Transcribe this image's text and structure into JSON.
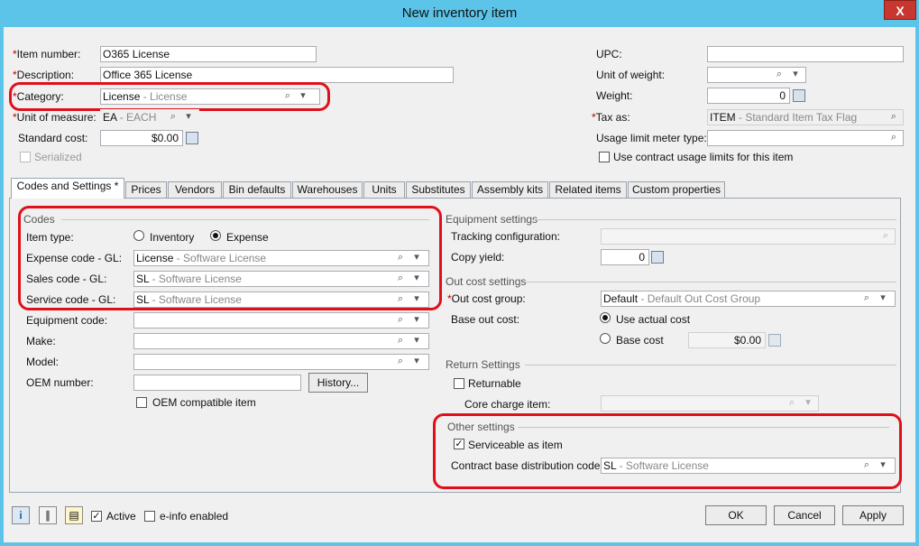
{
  "window": {
    "title": "New inventory item",
    "close": "X"
  },
  "header": {
    "item_number_label": "Item number:",
    "item_number": "O365 License",
    "description_label": "Description:",
    "description": "Office 365 License",
    "category_label": "Category:",
    "category_code": "License",
    "category_desc": "License",
    "uom_label": "Unit of measure:",
    "uom_code": "EA",
    "uom_desc": "EACH",
    "standard_cost_label": "Standard cost:",
    "standard_cost": "$0.00",
    "serialized_label": "Serialized",
    "upc_label": "UPC:",
    "upc": "",
    "unit_weight_label": "Unit of weight:",
    "weight_label": "Weight:",
    "weight": "0",
    "tax_label": "Tax as:",
    "tax_code": "ITEM",
    "tax_desc": "Standard Item Tax Flag",
    "usage_meter_label": "Usage limit meter type:",
    "use_contract_label": "Use contract usage limits for this item"
  },
  "tabs": [
    {
      "label": "Codes and Settings  *"
    },
    {
      "label": "Prices"
    },
    {
      "label": "Vendors"
    },
    {
      "label": "Bin defaults"
    },
    {
      "label": "Warehouses"
    },
    {
      "label": "Units"
    },
    {
      "label": "Substitutes"
    },
    {
      "label": "Assembly kits"
    },
    {
      "label": "Related items"
    },
    {
      "label": "Custom properties"
    }
  ],
  "codes": {
    "section": "Codes",
    "item_type_label": "Item type:",
    "inventory_label": "Inventory",
    "expense_label": "Expense",
    "expense_code_label": "Expense code - GL:",
    "expense_code": "License",
    "expense_desc": "Software License",
    "sales_code_label": "Sales code - GL:",
    "sales_code": "SL",
    "sales_desc": "Software License",
    "service_code_label": "Service code - GL:",
    "service_code": "SL",
    "service_desc": "Software License",
    "equipment_code_label": "Equipment code:",
    "make_label": "Make:",
    "model_label": "Model:",
    "oem_label": "OEM number:",
    "history_button": "History...",
    "oem_compatible_label": "OEM compatible item"
  },
  "equipment": {
    "section": "Equipment settings",
    "tracking_label": "Tracking configuration:",
    "copy_yield_label": "Copy yield:",
    "copy_yield": "0"
  },
  "outcost": {
    "section": "Out cost settings",
    "group_label": "Out cost group:",
    "group_code": "Default",
    "group_desc": "Default Out Cost Group",
    "base_label": "Base out cost:",
    "use_actual_label": "Use actual cost",
    "base_cost_label": "Base cost",
    "base_cost": "$0.00"
  },
  "return": {
    "section": "Return Settings",
    "returnable_label": "Returnable",
    "core_charge_label": "Core charge item:"
  },
  "other": {
    "section": "Other settings",
    "serviceable_label": "Serviceable as item",
    "distribution_label": "Contract base distribution code:",
    "distribution_code": "SL",
    "distribution_desc": "Software License"
  },
  "footer": {
    "active_label": "Active",
    "einfo_label": "e-info enabled",
    "ok": "OK",
    "cancel": "Cancel",
    "apply": "Apply"
  },
  "colors": {
    "titlebar": "#5bc4e8",
    "highlight": "#e0101a",
    "required": "#c00000"
  }
}
